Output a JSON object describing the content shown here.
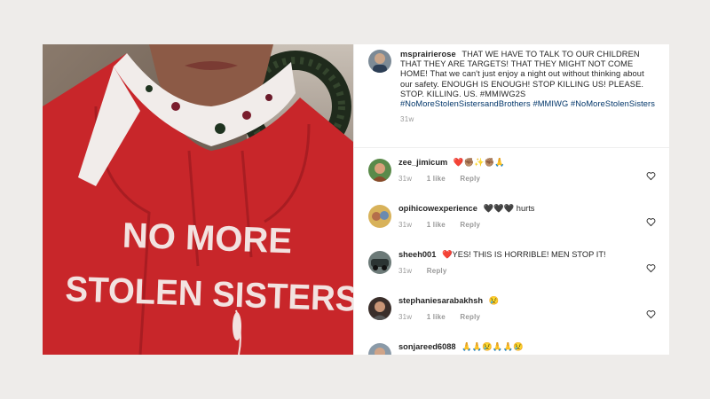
{
  "post": {
    "username": "msprairierose",
    "caption": "THAT WE HAVE TO TALK TO OUR CHILDREN THAT THEY ARE TARGETS! THAT THEY MIGHT NOT COME HOME! That we can't just enjoy a night out without thinking about our safety. ENOUGH IS ENOUGH! STOP KILLING US! PLEASE. STOP. KILLING. US. #MMIWG2S",
    "hashtags": "#NoMoreStolenSistersandBrothers  #MMIWG  #NoMoreStolenSisters",
    "time": "31w",
    "shirt_line1": "NO MORE",
    "shirt_line2": "STOLEN SISTERS"
  },
  "comments": [
    {
      "username": "zee_jimicum",
      "text": "❤️✊🏽✨✊🏽🙏",
      "time": "31w",
      "likes": "1 like",
      "reply": "Reply"
    },
    {
      "username": "opihicowexperience",
      "text": "🖤🖤🖤 hurts",
      "time": "31w",
      "likes": "1 like",
      "reply": "Reply"
    },
    {
      "username": "sheeh001",
      "text": "❤️YES! THIS IS HORRIBLE! MEN STOP IT!",
      "time": "31w",
      "likes": "",
      "reply": "Reply"
    },
    {
      "username": "stephaniesarabakhsh",
      "text": "😢",
      "time": "31w",
      "likes": "1 like",
      "reply": "Reply"
    },
    {
      "username": "sonjareed6088",
      "text": "🙏🙏😢🙏🙏😢",
      "time": "",
      "likes": "",
      "reply": ""
    }
  ],
  "colors": {
    "hoodie": "#c8262a",
    "link": "#003569",
    "muted": "#999999"
  }
}
